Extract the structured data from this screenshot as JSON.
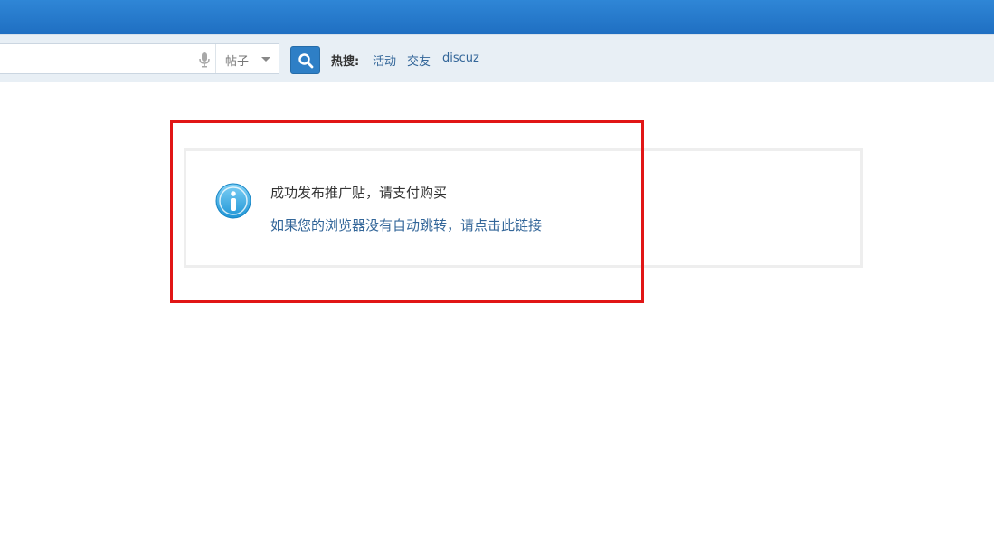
{
  "header": {
    "brand_color": "#1f6fc2"
  },
  "search": {
    "value": "",
    "type_label": "帖子",
    "button_color": "#2e7fc6",
    "hot_label": "热搜:",
    "hot_links": [
      "活动",
      "交友",
      "discuz"
    ]
  },
  "message": {
    "title": "成功发布推广贴，请支付购买",
    "redirect_link": "如果您的浏览器没有自动跳转，请点击此链接",
    "icon": "info-icon"
  },
  "highlight": {
    "color": "#e11616"
  }
}
